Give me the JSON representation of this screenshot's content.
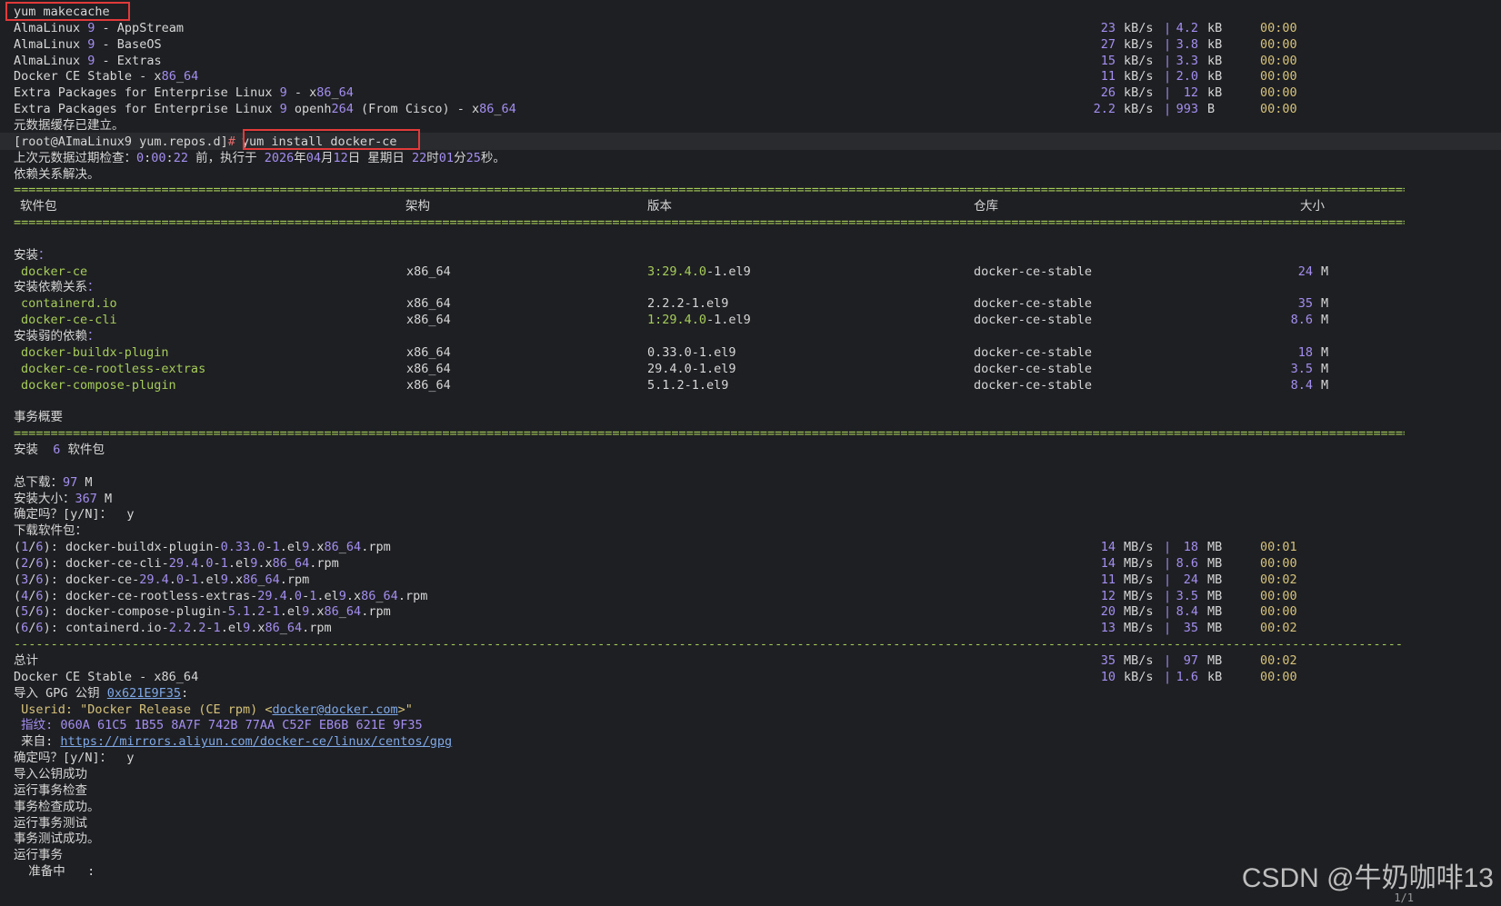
{
  "makecache": {
    "command": "yum makecache",
    "repos": [
      {
        "name": "AlmaLinux 9 - AppStream",
        "speed": "23",
        "speed_unit": "kB/s",
        "size": "4.2",
        "size_unit": "kB",
        "time": "00:00"
      },
      {
        "name": "AlmaLinux 9 - BaseOS",
        "speed": "27",
        "speed_unit": "kB/s",
        "size": "3.8",
        "size_unit": "kB",
        "time": "00:00"
      },
      {
        "name": "AlmaLinux 9 - Extras",
        "speed": "15",
        "speed_unit": "kB/s",
        "size": "3.3",
        "size_unit": "kB",
        "time": "00:00"
      },
      {
        "name": "Docker CE Stable - x86_64",
        "speed": "11",
        "speed_unit": "kB/s",
        "size": "2.0",
        "size_unit": "kB",
        "time": "00:00"
      },
      {
        "name": "Extra Packages for Enterprise Linux 9 - x86_64",
        "speed": "26",
        "speed_unit": "kB/s",
        "size": "12",
        "size_unit": "kB",
        "time": "00:00"
      },
      {
        "name": "Extra Packages for Enterprise Linux 9 openh264 (From Cisco) - x86_64",
        "speed": "2.2",
        "speed_unit": "kB/s",
        "size": "993",
        "size_unit": "B",
        "time": "00:00"
      }
    ],
    "done": "元数据缓存已建立。"
  },
  "prompt": {
    "text": "[root@AImaLinux9 yum.repos.d]",
    "hash": "#",
    "command": "yum install docker-ce"
  },
  "meta_check": "上次元数据过期检查：0:00:22 前，执行于 2026年04月12日 星期日 22时01分25秒。",
  "resolving": "依赖关系解决。",
  "separator": "================================================================================================================================================================================================",
  "dash_separator": "------------------------------------------------------------------------------------------------------------------------------------------------------------------------------------------------",
  "table_header": {
    "package": "软件包",
    "arch": "架构",
    "version": "版本",
    "repo": "仓库",
    "size": "大小"
  },
  "groups": [
    {
      "label": "安装：",
      "rows": [
        {
          "pkg": "docker-ce",
          "arch": "x86_64",
          "ver": "3:29.4.0-1.el9",
          "repo": "docker-ce-stable",
          "size": "24",
          "unit": "M"
        }
      ]
    },
    {
      "label": "安装依赖关系：",
      "rows": [
        {
          "pkg": "containerd.io",
          "arch": "x86_64",
          "ver": "2.2.2-1.el9",
          "repo": "docker-ce-stable",
          "size": "35",
          "unit": "M"
        },
        {
          "pkg": "docker-ce-cli",
          "arch": "x86_64",
          "ver": "1:29.4.0-1.el9",
          "repo": "docker-ce-stable",
          "size": "8.6",
          "unit": "M"
        }
      ]
    },
    {
      "label": "安装弱的依赖：",
      "rows": [
        {
          "pkg": "docker-buildx-plugin",
          "arch": "x86_64",
          "ver": "0.33.0-1.el9",
          "repo": "docker-ce-stable",
          "size": "18",
          "unit": "M"
        },
        {
          "pkg": "docker-ce-rootless-extras",
          "arch": "x86_64",
          "ver": "29.4.0-1.el9",
          "repo": "docker-ce-stable",
          "size": "3.5",
          "unit": "M"
        },
        {
          "pkg": "docker-compose-plugin",
          "arch": "x86_64",
          "ver": "5.1.2-1.el9",
          "repo": "docker-ce-stable",
          "size": "8.4",
          "unit": "M"
        }
      ]
    }
  ],
  "summary": {
    "title": "事务概要",
    "install_line": "安装  6 软件包",
    "total_download": "总下载：97 M",
    "install_size": "安装大小：367 M",
    "confirm": "确定吗？[y/N]：  y",
    "downloading": "下载软件包："
  },
  "downloads": [
    {
      "file": "(1/6): docker-buildx-plugin-0.33.0-1.el9.x86_64.rpm",
      "speed": "14",
      "speed_unit": "MB/s",
      "size": "18",
      "size_unit": "MB",
      "time": "00:01"
    },
    {
      "file": "(2/6): docker-ce-cli-29.4.0-1.el9.x86_64.rpm",
      "speed": "14",
      "speed_unit": "MB/s",
      "size": "8.6",
      "size_unit": "MB",
      "time": "00:00"
    },
    {
      "file": "(3/6): docker-ce-29.4.0-1.el9.x86_64.rpm",
      "speed": "11",
      "speed_unit": "MB/s",
      "size": "24",
      "size_unit": "MB",
      "time": "00:02"
    },
    {
      "file": "(4/6): docker-ce-rootless-extras-29.4.0-1.el9.x86_64.rpm",
      "speed": "12",
      "speed_unit": "MB/s",
      "size": "3.5",
      "size_unit": "MB",
      "time": "00:00"
    },
    {
      "file": "(5/6): docker-compose-plugin-5.1.2-1.el9.x86_64.rpm",
      "speed": "20",
      "speed_unit": "MB/s",
      "size": "8.4",
      "size_unit": "MB",
      "time": "00:00"
    },
    {
      "file": "(6/6): containerd.io-2.2.2-1.el9.x86_64.rpm",
      "speed": "13",
      "speed_unit": "MB/s",
      "size": "35",
      "size_unit": "MB",
      "time": "00:02"
    }
  ],
  "totals": [
    {
      "label": "总计",
      "speed": "35",
      "speed_unit": "MB/s",
      "size": "97",
      "size_unit": "MB",
      "time": "00:02"
    },
    {
      "label": "Docker CE Stable - x86_64",
      "speed": "10",
      "speed_unit": "kB/s",
      "size": "1.6",
      "size_unit": "kB",
      "time": "00:00"
    }
  ],
  "gpg": {
    "import_prefix": "导入 GPG 公钥 ",
    "key_id": "0x621E9F35",
    "import_suffix": ":",
    "userid_prefix": " Userid: \"Docker Release (CE rpm) <",
    "email": "docker@docker.com",
    "userid_suffix": ">\"",
    "fingerprint": " 指纹: 060A 61C5 1B55 8A7F 742B 77AA C52F EB6B 621E 9F35",
    "from_prefix": " 来自: ",
    "from_url": "https://mirrors.aliyun.com/docker-ce/linux/centos/gpg"
  },
  "tail": [
    "确定吗？[y/N]：  y",
    "导入公钥成功",
    "运行事务检查",
    "事务检查成功。",
    "运行事务测试",
    "事务测试成功。",
    "运行事务",
    "  准备中   :"
  ],
  "watermark": "CSDN @牛奶咖啡13",
  "page_indicator": "1/1",
  "colors": {
    "highlight_box": "#e23a3a",
    "number": "#a48ef0",
    "package": "#a6cc5a",
    "background": "#1e1f22"
  }
}
